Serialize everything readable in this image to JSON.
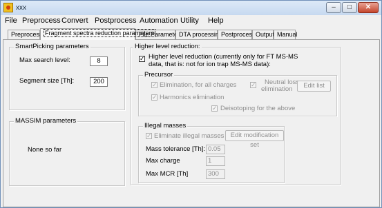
{
  "window": {
    "title": "xxx"
  },
  "menu": [
    "File",
    "Preprocess",
    "Convert",
    "Postprocess",
    "Automation",
    "Utility",
    "Help"
  ],
  "tabs": [
    "Preprocess",
    "Fragment spectra reduction parameters",
    "File Parameters",
    "DTA processing",
    "Postprocess",
    "Output",
    "Manual"
  ],
  "smartpicking": {
    "title": "SmartPicking parameters",
    "max_search_label": "Max search level:",
    "max_search_value": "8",
    "segment_label": "Segment size [Th]:",
    "segment_value": "200"
  },
  "massim": {
    "title": "MASSIM parameters",
    "note": "None so far"
  },
  "higher": {
    "title": "Higher level reduction:",
    "checkbox_line1": "Higher level reduction (currently only for FT MS-MS",
    "checkbox_line2": "data, that is: not for ion trap MS-MS data):"
  },
  "precursor": {
    "title": "Precursor",
    "elim_charges": "Elimination, for all charges",
    "harmonics": "Harmonics elimination",
    "neutral_loss_line1": "Neutral loss",
    "neutral_loss_line2": "elimination",
    "edit_list": "Edit list",
    "deisotoping": "Deisotoping for the above"
  },
  "illegal": {
    "title": "Illegal masses",
    "eliminate": "Eliminate illegal masses",
    "edit_mod": "Edit modification set",
    "mass_tol_label": "Mass tolerance [Th]:",
    "mass_tol_value": "0.05",
    "max_charge_label": "Max charge",
    "max_charge_value": "1",
    "max_mcr_label": "Max MCR [Th]",
    "max_mcr_value": "300"
  }
}
